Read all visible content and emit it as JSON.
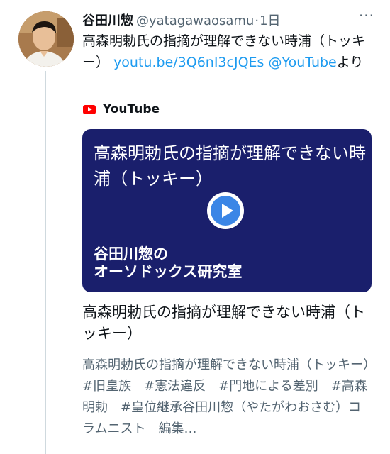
{
  "author": {
    "name": "谷田川惣",
    "handle": "@yatagawaosamu",
    "separator": "·",
    "timestamp": "1日"
  },
  "more_button": {
    "icon": "more-horizontal-icon",
    "label": "···"
  },
  "tweet": {
    "text_before_link": "高森明勅氏の指摘が理解できない時浦（トッキー）",
    "link_text": "youtu.be/3Q6nI3cJQEs",
    "mention_text": "@YouTube",
    "text_after_mention": "より"
  },
  "card": {
    "source": "YouTube",
    "source_icon": "youtube-logo-icon",
    "thumbnail_title": "高森明勅氏の指摘が理解できない時浦（トッキー）",
    "thumbnail_channel": "谷田川惣の\nオーソドックス研究室",
    "title": "高森明勅氏の指摘が理解できない時浦（トッキー）",
    "description": "高森明勅氏の指摘が理解できない時浦（トッキー）#旧皇族　#憲法違反　#門地による差別　#高森明勅　#皇位継承谷田川惣（やたがわおさむ）コラムニスト　編集…"
  },
  "colors": {
    "link": "#1d9bf0",
    "secondary_text": "#536471",
    "thumbnail_background": "#1a1f6c",
    "play_button": "#3b86e6",
    "youtube_red": "#ff0000"
  }
}
